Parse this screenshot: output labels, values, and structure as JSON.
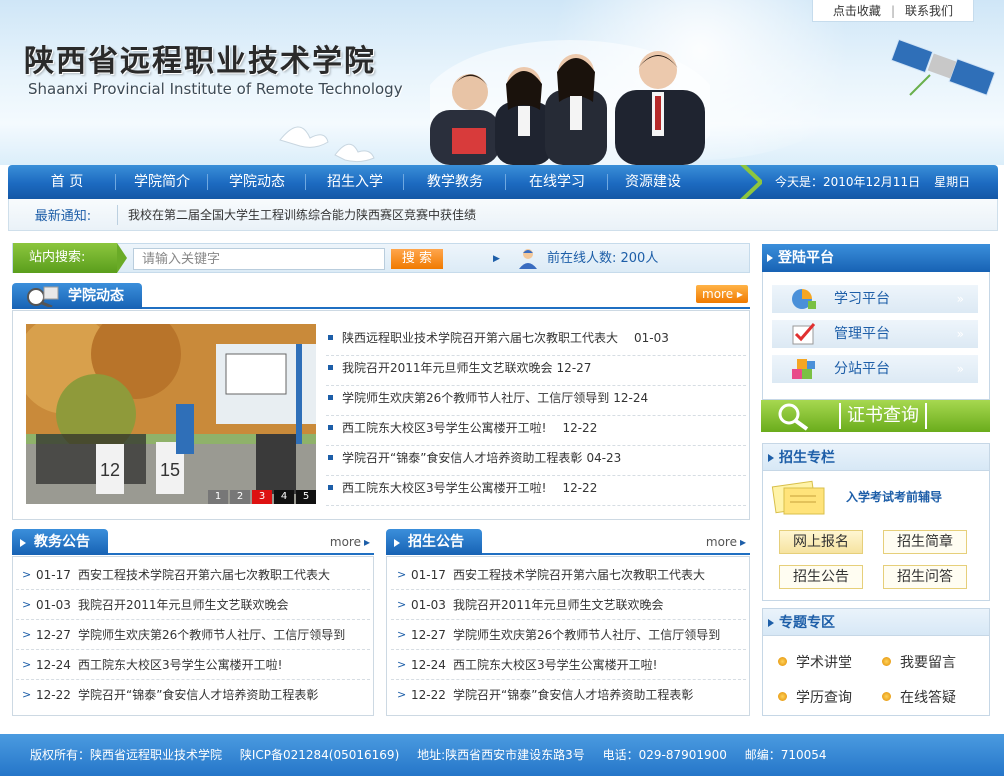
{
  "header": {
    "title_cn": "陕西省远程职业技术学院",
    "title_en": "Shaanxi Provincial Institute of Remote Technology",
    "links": [
      "点击收藏",
      "联系我们"
    ]
  },
  "nav": {
    "items": [
      "首 页",
      "学院简介",
      "学院动态",
      "招生入学",
      "教学教务",
      "在线学习",
      "资源建设"
    ],
    "date": "今天是：2010年12月11日",
    "weekday": "星期日"
  },
  "notice": {
    "label": "最新通知:",
    "text": "我校在第二届全国大学生工程训练综合能力陕西赛区竞赛中获佳绩"
  },
  "search": {
    "label": "站内搜索:",
    "placeholder": "请输入关键字",
    "button": "搜 索",
    "online": "前在线人数: 200人"
  },
  "news": {
    "title": "学院动态",
    "more": "more",
    "pager": [
      "1",
      "2",
      "3",
      "4",
      "5"
    ],
    "items": [
      {
        "text": "陕西远程职业技术学院召开第六届七次教职工代表大",
        "date": "01-03"
      },
      {
        "text": "我院召开2011年元旦师生文艺联欢晚会",
        "date": "12-27"
      },
      {
        "text": "学院师生欢庆第26个教师节人社厅、工信厅领导到",
        "date": "12-24"
      },
      {
        "text": "西工院东大校区3号学生公寓楼开工啦!",
        "date": "12-22"
      },
      {
        "text": "学院召开“锦泰”食安信人才培养资助工程表彰",
        "date": "04-23"
      },
      {
        "text": "西工院东大校区3号学生公寓楼开工啦!",
        "date": "12-22"
      }
    ]
  },
  "jiaowu": {
    "title": "教务公告",
    "more": "more",
    "items": [
      {
        "date": "01-17",
        "text": "西安工程技术学院召开第六届七次教职工代表大"
      },
      {
        "date": "01-03",
        "text": "我院召开2011年元旦师生文艺联欢晚会"
      },
      {
        "date": "12-27",
        "text": "学院师生欢庆第26个教师节人社厅、工信厅领导到"
      },
      {
        "date": "12-24",
        "text": "西工院东大校区3号学生公寓楼开工啦!"
      },
      {
        "date": "12-22",
        "text": "学院召开“锦泰”食安信人才培养资助工程表彰"
      }
    ]
  },
  "zhaosheng": {
    "title": "招生公告",
    "more": "more",
    "items": [
      {
        "date": "01-17",
        "text": "西安工程技术学院召开第六届七次教职工代表大"
      },
      {
        "date": "01-03",
        "text": "我院召开2011年元旦师生文艺联欢晚会"
      },
      {
        "date": "12-27",
        "text": "学院师生欢庆第26个教师节人社厅、工信厅领导到"
      },
      {
        "date": "12-24",
        "text": "西工院东大校区3号学生公寓楼开工啦!"
      },
      {
        "date": "12-22",
        "text": "学院召开“锦泰”食安信人才培养资助工程表彰"
      }
    ]
  },
  "login": {
    "title": "登陆平台",
    "items": [
      "学习平台",
      "管理平台",
      "分站平台"
    ],
    "chevron": "»"
  },
  "cert": {
    "label": "证书查询"
  },
  "admission": {
    "title": "招生专栏",
    "subtitle": "入学考试考前辅导",
    "buttons": [
      "网上报名",
      "招生简章",
      "招生公告",
      "招生问答"
    ]
  },
  "topics": {
    "title": "专题专区",
    "items": [
      "学术讲堂",
      "我要留言",
      "学历查询",
      "在线答疑"
    ]
  },
  "footer": {
    "copyright": "版权所有：陕西省远程职业技术学院",
    "icp": "陕ICP备021284(05016169)",
    "address": "地址:陕西省西安市建设东路3号",
    "phone": "电话：029-87901900",
    "postcode": "邮编：710054"
  },
  "colors": {
    "nav_blue": "#1c6ac0",
    "green": "#6aac1c",
    "orange": "#f07a00"
  }
}
